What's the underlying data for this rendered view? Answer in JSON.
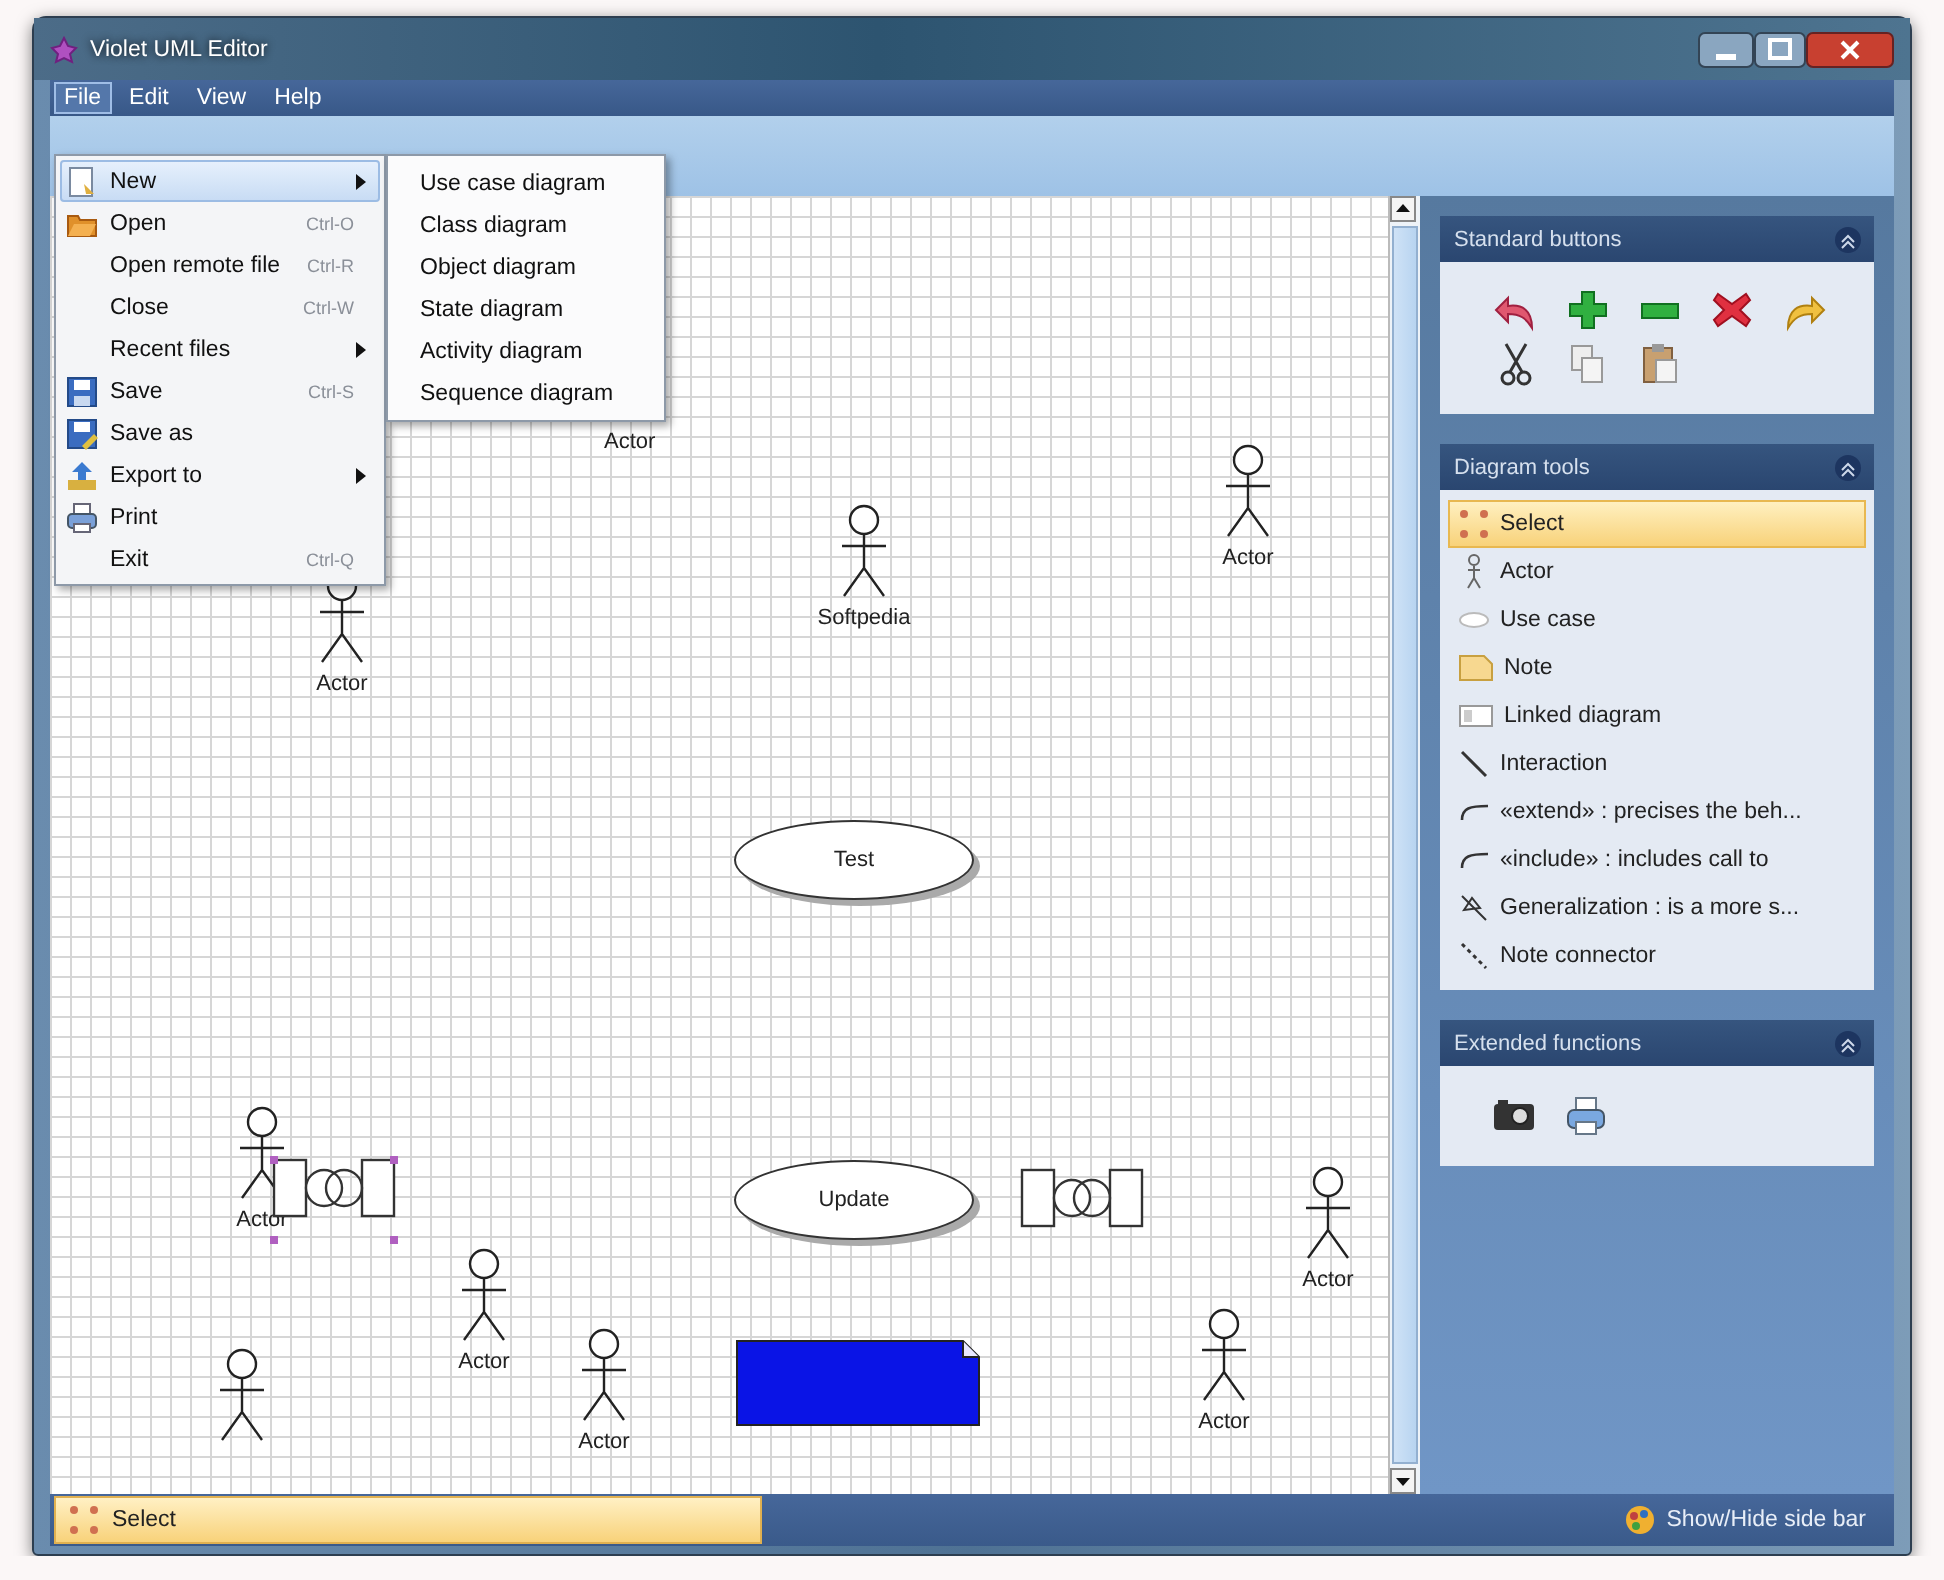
{
  "window": {
    "title": "Violet UML Editor"
  },
  "menu_bar": [
    {
      "label": "File",
      "selected": true
    },
    {
      "label": "Edit",
      "selected": false
    },
    {
      "label": "View",
      "selected": false
    },
    {
      "label": "Help",
      "selected": false
    }
  ],
  "file_menu": [
    {
      "label": "New",
      "submenu": true,
      "selected": true
    },
    {
      "label": "Open",
      "shortcut": "Ctrl-O",
      "submenu": false,
      "selected": false
    },
    {
      "label": "Open remote file",
      "shortcut": "Ctrl-R",
      "submenu": false,
      "selected": false
    },
    {
      "label": "Close",
      "shortcut": "Ctrl-W",
      "submenu": false,
      "selected": false
    },
    {
      "label": "Recent files",
      "submenu": true,
      "selected": false
    },
    {
      "label": "Save",
      "shortcut": "Ctrl-S",
      "submenu": false,
      "selected": false
    },
    {
      "label": "Save as",
      "submenu": false,
      "selected": false
    },
    {
      "label": "Export to",
      "submenu": true,
      "selected": false
    },
    {
      "label": "Print",
      "submenu": false,
      "selected": false
    },
    {
      "label": "Exit",
      "shortcut": "Ctrl-Q",
      "submenu": false,
      "selected": false
    }
  ],
  "new_submenu": [
    "Use case diagram",
    "Class diagram",
    "Object diagram",
    "State diagram",
    "Activity diagram",
    "Sequence diagram"
  ],
  "diagram": {
    "nodes": [
      {
        "kind": "text",
        "label": "Actor",
        "selected": false
      },
      {
        "kind": "actor",
        "label": "Actor",
        "selected": false
      },
      {
        "kind": "actor",
        "label": "Softpedia",
        "selected": false
      },
      {
        "kind": "actor",
        "label": "Actor",
        "selected": false
      },
      {
        "kind": "usecase",
        "label": "Test",
        "selected": false
      },
      {
        "kind": "actor",
        "label": "Actor",
        "selected": false
      },
      {
        "kind": "link",
        "selected": true
      },
      {
        "kind": "usecase",
        "label": "Update",
        "selected": false
      },
      {
        "kind": "link",
        "selected": false
      },
      {
        "kind": "actor",
        "label": "Actor",
        "selected": false
      },
      {
        "kind": "actor",
        "label": "Actor",
        "selected": false
      },
      {
        "kind": "actor",
        "label": "Actor",
        "selected": false
      },
      {
        "kind": "note",
        "selected": false
      },
      {
        "kind": "actor",
        "selected": false
      },
      {
        "kind": "actor",
        "label": "Actor",
        "selected": false
      }
    ]
  },
  "sidebar": {
    "panels": [
      {
        "kind": "buttons",
        "title": "Standard buttons"
      },
      {
        "kind": "tools",
        "title": "Diagram tools",
        "items": [
          {
            "label": "Select",
            "selected": true
          },
          {
            "label": "Actor",
            "selected": false
          },
          {
            "label": "Use case",
            "selected": false
          },
          {
            "label": "Note",
            "selected": false
          },
          {
            "label": "Linked diagram",
            "selected": false
          },
          {
            "label": "Interaction",
            "selected": false
          },
          {
            "label": "«extend» : precises the beh...",
            "selected": false
          },
          {
            "label": "«include» : includes call to",
            "selected": false
          },
          {
            "label": "Generalization : is a more s...",
            "selected": false
          },
          {
            "label": "Note connector",
            "selected": false
          }
        ]
      },
      {
        "kind": "functions",
        "title": "Extended functions"
      }
    ]
  },
  "status_bar": {
    "tool": "Select",
    "toggle": "Show/Hide side bar"
  }
}
